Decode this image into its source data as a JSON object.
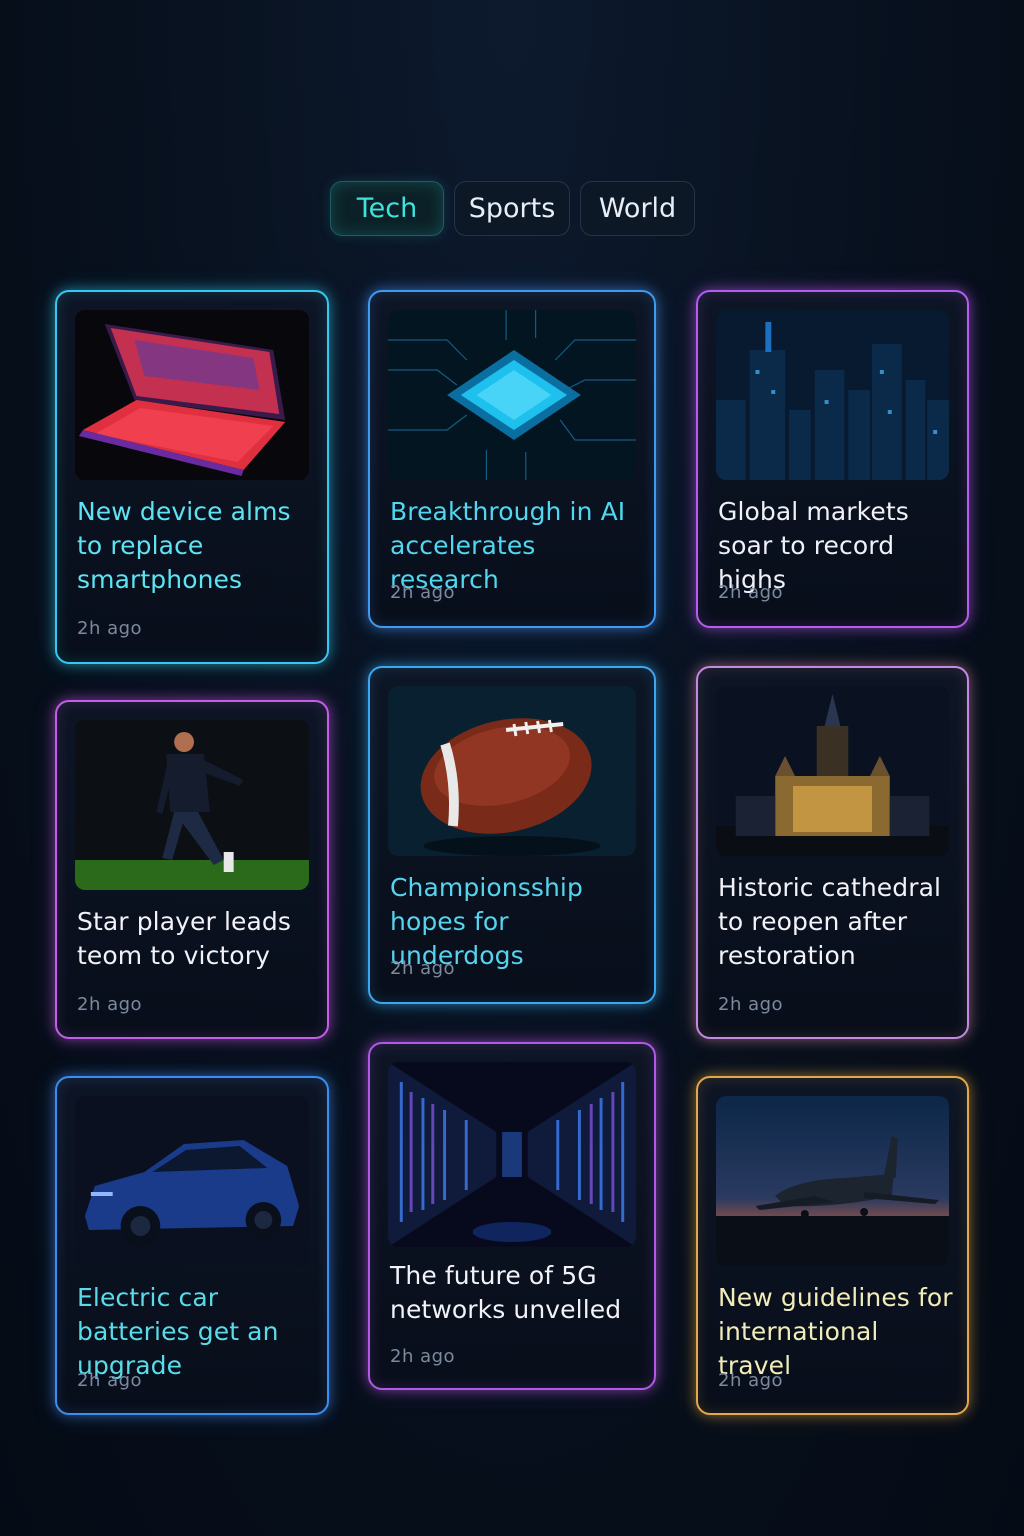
{
  "tabs": [
    {
      "label": "Tech",
      "active": true
    },
    {
      "label": "Sports",
      "active": false
    },
    {
      "label": "World",
      "active": false
    }
  ],
  "articles": [
    {
      "title": "New device alms to replace smartphones",
      "time": "2h ago",
      "image": "laptop-image",
      "category": "Tech"
    },
    {
      "title": "Breakthrough in AI accelerates research",
      "time": "2h ago",
      "image": "chip-image",
      "category": "Tech"
    },
    {
      "title": "Global markets soar to record highs",
      "time": "2h ago",
      "image": "skyline-image",
      "category": "World"
    },
    {
      "title": "Star player leads teom to victory",
      "time": "2h ago",
      "image": "soccer-player-image",
      "category": "Sports"
    },
    {
      "title": "Championsship hopes for underdogs",
      "time": "2h ago",
      "image": "football-image",
      "category": "Sports"
    },
    {
      "title": "Historic cathedral to reopen after restoration",
      "time": "2h ago",
      "image": "cathedral-image",
      "category": "World"
    },
    {
      "title": "Electric car batteries get an upgrade",
      "time": "2h ago",
      "image": "electric-car-image",
      "category": "Tech"
    },
    {
      "title": "The future of 5G networks unvelled",
      "time": "2h ago",
      "image": "server-room-image",
      "category": "Tech"
    },
    {
      "title": "New guidelines for international travel",
      "time": "2h ago",
      "image": "airplane-image",
      "category": "World"
    }
  ],
  "colors": {
    "background": "#07101d",
    "active_tab_text": "#3fe3da",
    "cyan_border": "#35c9f0",
    "purple_border": "#b45ef0",
    "gold_border": "#e3a84a"
  }
}
